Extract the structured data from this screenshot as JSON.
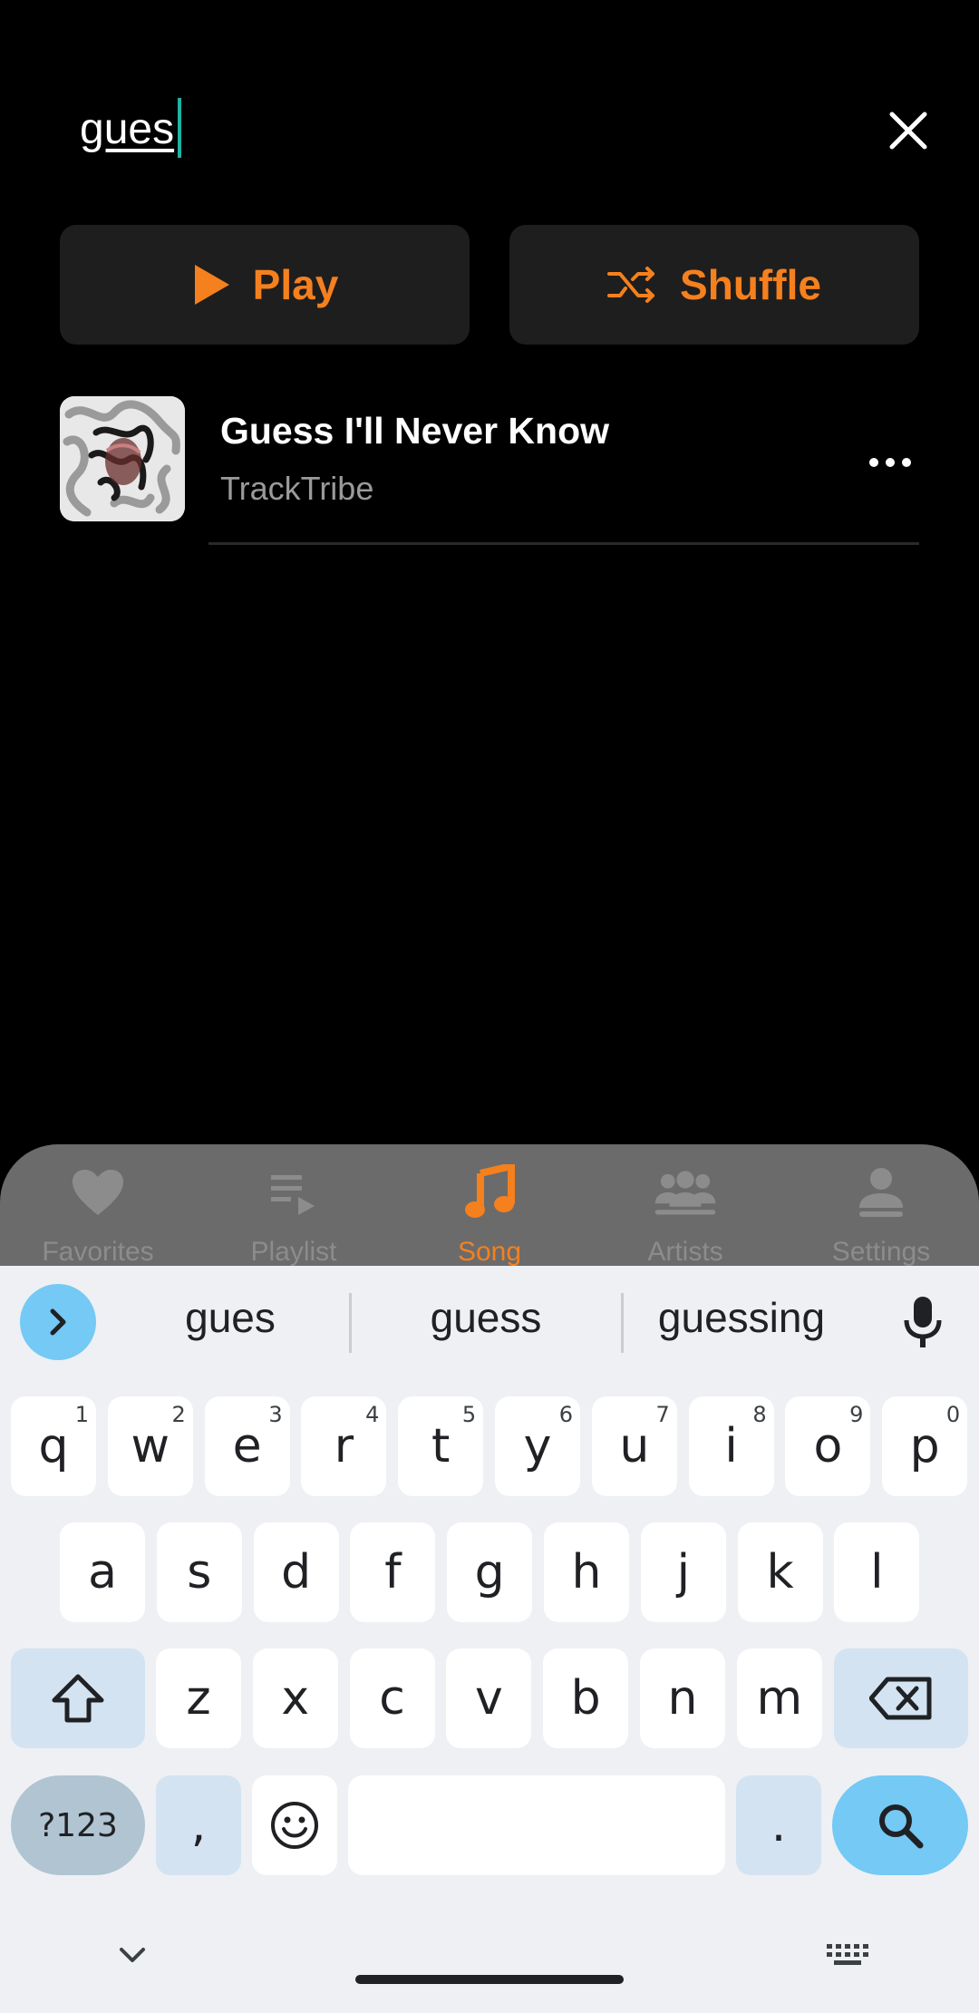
{
  "search": {
    "query": "gues"
  },
  "actions": {
    "play_label": "Play",
    "shuffle_label": "Shuffle"
  },
  "song": {
    "title": "Guess I'll Never Know",
    "artist": "TrackTribe"
  },
  "nav": {
    "items": [
      {
        "label": "Favorites",
        "icon": "heart-icon"
      },
      {
        "label": "Playlist",
        "icon": "playlist-icon"
      },
      {
        "label": "Song",
        "icon": "music-note-icon",
        "active": true
      },
      {
        "label": "Artists",
        "icon": "group-icon"
      },
      {
        "label": "Settings",
        "icon": "person-icon"
      }
    ]
  },
  "keyboard": {
    "suggestions": [
      "gues",
      "guess",
      "guessing"
    ],
    "row1": [
      {
        "k": "q",
        "h": "1"
      },
      {
        "k": "w",
        "h": "2"
      },
      {
        "k": "e",
        "h": "3"
      },
      {
        "k": "r",
        "h": "4"
      },
      {
        "k": "t",
        "h": "5"
      },
      {
        "k": "y",
        "h": "6"
      },
      {
        "k": "u",
        "h": "7"
      },
      {
        "k": "i",
        "h": "8"
      },
      {
        "k": "o",
        "h": "9"
      },
      {
        "k": "p",
        "h": "0"
      }
    ],
    "row2": [
      "a",
      "s",
      "d",
      "f",
      "g",
      "h",
      "j",
      "k",
      "l"
    ],
    "row3": [
      "z",
      "x",
      "c",
      "v",
      "b",
      "n",
      "m"
    ],
    "symbols_label": "?123",
    "comma": ",",
    "period": "."
  },
  "colors": {
    "accent": "#f5801e",
    "caret": "#1fb3a3",
    "nav_bg": "#6b6b6b",
    "keyboard_bg": "#eef0f4"
  }
}
